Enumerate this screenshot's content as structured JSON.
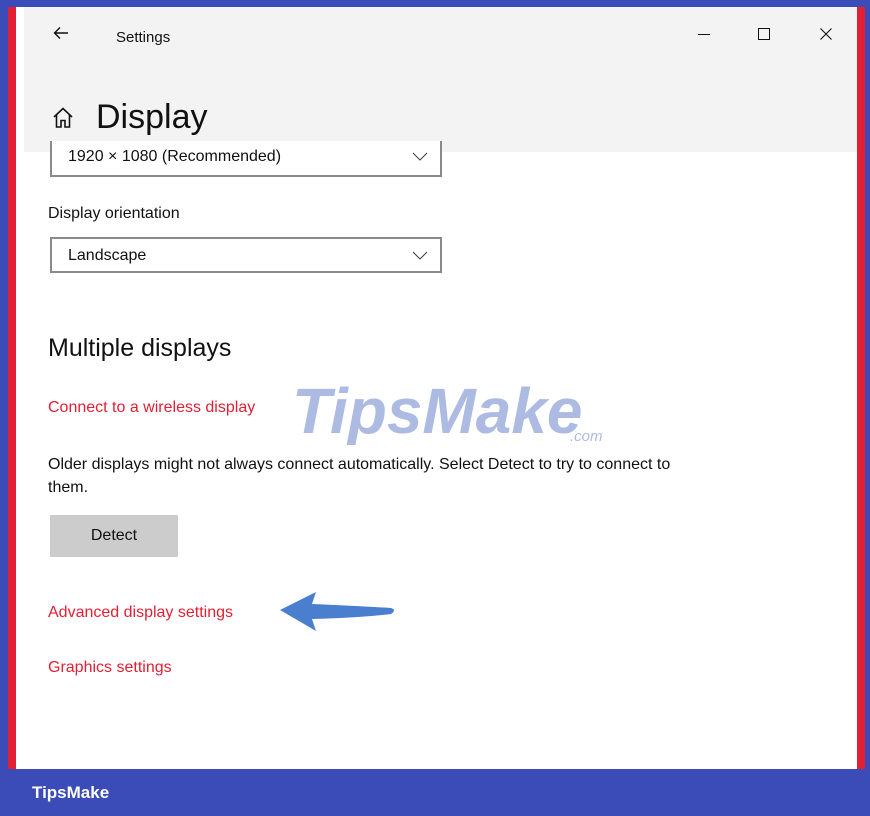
{
  "window": {
    "app_title": "Settings",
    "page_title": "Display"
  },
  "resolution": {
    "value": "1920 × 1080 (Recommended)"
  },
  "orientation": {
    "label": "Display orientation",
    "value": "Landscape"
  },
  "multiple_displays": {
    "title": "Multiple displays",
    "wireless_link": "Connect to a wireless display",
    "description": "Older displays might not always connect automatically. Select Detect to try to connect to them.",
    "detect_label": "Detect",
    "advanced_link": "Advanced display settings",
    "graphics_link": "Graphics settings"
  },
  "watermark": {
    "brand": "TipsMake",
    "suffix": ".com"
  },
  "footer": {
    "label": "TipsMake"
  },
  "icons": {
    "back": "back-arrow-icon",
    "minimize": "minimize-icon",
    "maximize": "maximize-icon",
    "close": "close-icon",
    "home": "home-icon",
    "chevron": "chevron-down-icon",
    "pointer": "pointer-arrow-icon"
  },
  "colors": {
    "frame": "#3b4cb8",
    "accent_border": "#e21f33",
    "link": "#e21f33",
    "titlebar_bg": "#f3f3f3",
    "button_bg": "#cccccc",
    "arrow": "#4a7fd0"
  }
}
